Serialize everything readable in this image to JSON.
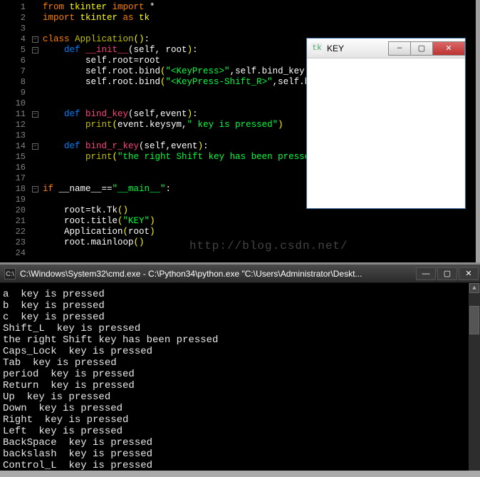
{
  "editor": {
    "line_numbers": [
      "1",
      "2",
      "3",
      "4",
      "5",
      "6",
      "7",
      "8",
      "9",
      "10",
      "11",
      "12",
      "13",
      "14",
      "15",
      "16",
      "17",
      "18",
      "19",
      "20",
      "21",
      "22",
      "23",
      "24"
    ],
    "code": [
      [
        [
          "c-kw",
          "from "
        ],
        [
          "c-imp",
          "tkinter "
        ],
        [
          "c-kw",
          "import"
        ],
        [
          "c-plain",
          " *"
        ]
      ],
      [
        [
          "c-kw",
          "import "
        ],
        [
          "c-imp",
          "tkinter "
        ],
        [
          "c-kw",
          "as "
        ],
        [
          "c-imp",
          "tk"
        ]
      ],
      [
        [
          "c-plain",
          ""
        ]
      ],
      [
        [
          "c-kw",
          "class "
        ],
        [
          "c-name",
          "Application"
        ],
        [
          "c-paren",
          "()"
        ],
        [
          "c-plain",
          ":"
        ]
      ],
      [
        [
          "c-plain",
          "    "
        ],
        [
          "c-def",
          "def "
        ],
        [
          "c-fn",
          "__init__"
        ],
        [
          "c-plain",
          "(self, root"
        ],
        [
          "c-paren",
          ")"
        ],
        [
          "c-plain",
          ":"
        ]
      ],
      [
        [
          "c-plain",
          "        self.root=root"
        ]
      ],
      [
        [
          "c-plain",
          "        self.root.bind"
        ],
        [
          "c-paren",
          "("
        ],
        [
          "c-str",
          "\"<KeyPress>\""
        ],
        [
          "c-plain",
          ",self.bind_key"
        ],
        [
          "c-paren",
          ")"
        ]
      ],
      [
        [
          "c-plain",
          "        self.root.bind"
        ],
        [
          "c-paren",
          "("
        ],
        [
          "c-str",
          "\"<KeyPress-Shift_R>\""
        ],
        [
          "c-plain",
          ",self.bind_r_key"
        ],
        [
          "c-paren",
          ")"
        ]
      ],
      [
        [
          "c-plain",
          ""
        ]
      ],
      [
        [
          "c-plain",
          ""
        ]
      ],
      [
        [
          "c-plain",
          "    "
        ],
        [
          "c-def",
          "def "
        ],
        [
          "c-fn",
          "bind_key"
        ],
        [
          "c-plain",
          "(self,event"
        ],
        [
          "c-paren",
          ")"
        ],
        [
          "c-plain",
          ":"
        ]
      ],
      [
        [
          "c-plain",
          "        "
        ],
        [
          "c-name",
          "print"
        ],
        [
          "c-paren",
          "("
        ],
        [
          "c-plain",
          "event.keysym,"
        ],
        [
          "c-str",
          "\" key is pressed\""
        ],
        [
          "c-paren",
          ")"
        ]
      ],
      [
        [
          "c-plain",
          ""
        ]
      ],
      [
        [
          "c-plain",
          "    "
        ],
        [
          "c-def",
          "def "
        ],
        [
          "c-fn",
          "bind_r_key"
        ],
        [
          "c-plain",
          "(self,event"
        ],
        [
          "c-paren",
          ")"
        ],
        [
          "c-plain",
          ":"
        ]
      ],
      [
        [
          "c-plain",
          "        "
        ],
        [
          "c-name",
          "print"
        ],
        [
          "c-paren",
          "("
        ],
        [
          "c-str",
          "\"the right Shift key has been pressed\""
        ],
        [
          "c-paren",
          ")"
        ]
      ],
      [
        [
          "c-plain",
          ""
        ]
      ],
      [
        [
          "c-plain",
          ""
        ]
      ],
      [
        [
          "c-kw",
          "if "
        ],
        [
          "c-plain",
          "__name__=="
        ],
        [
          "c-str",
          "\"__main__\""
        ],
        [
          "c-plain",
          ":"
        ]
      ],
      [
        [
          "c-plain",
          ""
        ]
      ],
      [
        [
          "c-plain",
          "    root=tk.Tk"
        ],
        [
          "c-paren",
          "()"
        ]
      ],
      [
        [
          "c-plain",
          "    root.title"
        ],
        [
          "c-paren",
          "("
        ],
        [
          "c-str",
          "\"KEY\""
        ],
        [
          "c-paren",
          ")"
        ]
      ],
      [
        [
          "c-plain",
          "    Application"
        ],
        [
          "c-paren",
          "("
        ],
        [
          "c-plain",
          "root"
        ],
        [
          "c-paren",
          ")"
        ]
      ],
      [
        [
          "c-plain",
          "    root.mainloop"
        ],
        [
          "c-paren",
          "()"
        ]
      ],
      [
        [
          "c-plain",
          ""
        ]
      ]
    ],
    "fold_marks": {
      "4": "−",
      "5": "−",
      "11": "−",
      "14": "−",
      "18": "−"
    }
  },
  "watermark": "http://blog.csdn.net/",
  "popup": {
    "title": "KEY",
    "icon": "tk"
  },
  "console": {
    "title": "C:\\Windows\\System32\\cmd.exe - C:\\Python34\\python.exe  \"C:\\Users\\Administrator\\Deskt...",
    "lines": [
      "a  key is pressed",
      "b  key is pressed",
      "c  key is pressed",
      "Shift_L  key is pressed",
      "the right Shift key has been pressed",
      "Caps_Lock  key is pressed",
      "Tab  key is pressed",
      "period  key is pressed",
      "Return  key is pressed",
      "Up  key is pressed",
      "Down  key is pressed",
      "Right  key is pressed",
      "Left  key is pressed",
      "BackSpace  key is pressed",
      "backslash  key is pressed",
      "Control_L  key is pressed"
    ]
  }
}
